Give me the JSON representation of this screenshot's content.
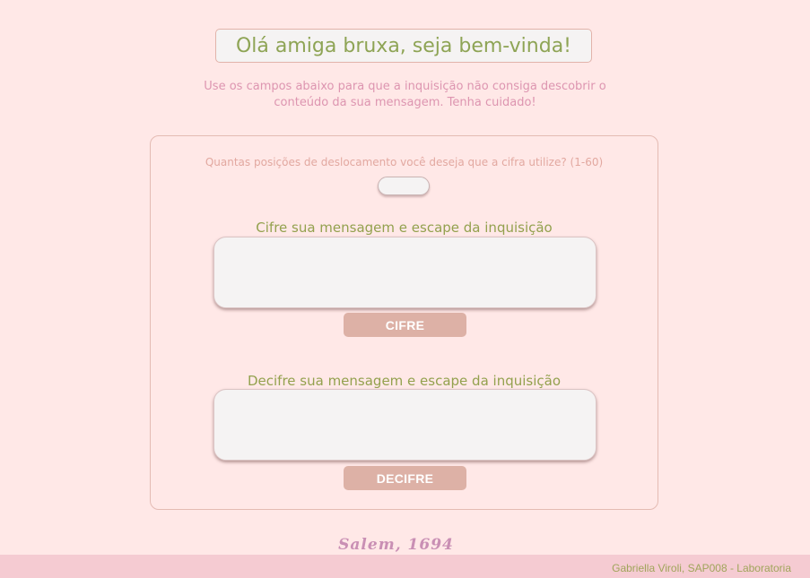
{
  "header": {
    "title": "Olá amiga bruxa, seja bem-vinda!",
    "subtitle": "Use os campos abaixo para que a inquisição não consiga descobrir o conteúdo da sua mensagem. Tenha cuidado!"
  },
  "form": {
    "shift_label": "Quantas posições de deslocamento você deseja que a cifra utilize? (1-60)",
    "shift_value": "",
    "encrypt_label": "Cifre sua mensagem e escape da inquisição",
    "encrypt_value": "",
    "encrypt_button": "CIFRE",
    "decrypt_label": "Decifre sua mensagem e escape da inquisição",
    "decrypt_value": "",
    "decrypt_button": "DECIFRE"
  },
  "signature": "Salem, 1694",
  "footer": {
    "credit": "Gabriella Viroli, SAP008 - Laboratoria"
  },
  "colors": {
    "background": "#ffe8e7",
    "accent_green": "#93a14e",
    "accent_pink": "#dd95b0",
    "button": "#ddb1a6",
    "footer": "#f5cbd2"
  }
}
